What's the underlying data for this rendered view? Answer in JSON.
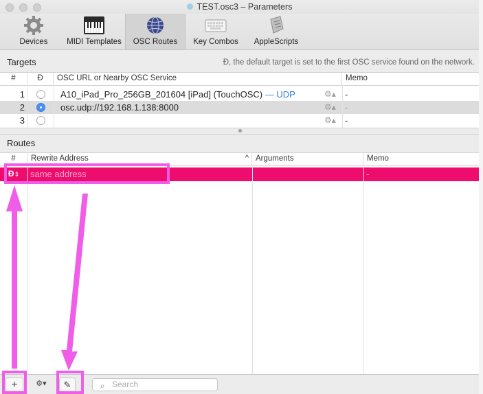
{
  "window": {
    "title": "TEST.osc3 – Parameters"
  },
  "toolbar": {
    "items": [
      {
        "label": "Devices",
        "icon": "gear-icon"
      },
      {
        "label": "MIDI Templates",
        "icon": "piano-icon"
      },
      {
        "label": "OSC Routes",
        "icon": "globe-icon",
        "selected": true
      },
      {
        "label": "Key Combos",
        "icon": "keyboard-icon"
      },
      {
        "label": "AppleScripts",
        "icon": "script-icon"
      }
    ]
  },
  "targets": {
    "title": "Targets",
    "hint": "Đ, the default target is set to the first OSC service found on the network.",
    "headers": {
      "num": "#",
      "default": "Đ",
      "url": "OSC URL or Nearby OSC Service",
      "memo": "Memo"
    },
    "rows": [
      {
        "num": "1",
        "default": false,
        "url": "A10_iPad_Pro_256GB_201604 [iPad] (TouchOSC)",
        "suffix": " — UDP",
        "memo": "-"
      },
      {
        "num": "2",
        "default": true,
        "url": "osc.udp://192.168.1.138:8000",
        "suffix": "",
        "memo": "-"
      },
      {
        "num": "3",
        "default": false,
        "url": "",
        "suffix": "",
        "memo": "-"
      }
    ]
  },
  "routes": {
    "title": "Routes",
    "headers": {
      "num": "#",
      "rewrite": "Rewrite Address",
      "arguments": "Arguments",
      "memo": "Memo"
    },
    "rows": [
      {
        "num": "Đ",
        "rewrite_placeholder": "same address",
        "arguments": "",
        "memo": "-"
      }
    ]
  },
  "bottom": {
    "add_label": "+",
    "gear_label": "⚙▾",
    "edit_label": "✎",
    "search_placeholder": "Search"
  },
  "colors": {
    "route_highlight": "#ee0c6e",
    "annotation": "#ef5de9",
    "selected_row": "#dcdcdc",
    "udp_link": "#2f7fd9"
  }
}
